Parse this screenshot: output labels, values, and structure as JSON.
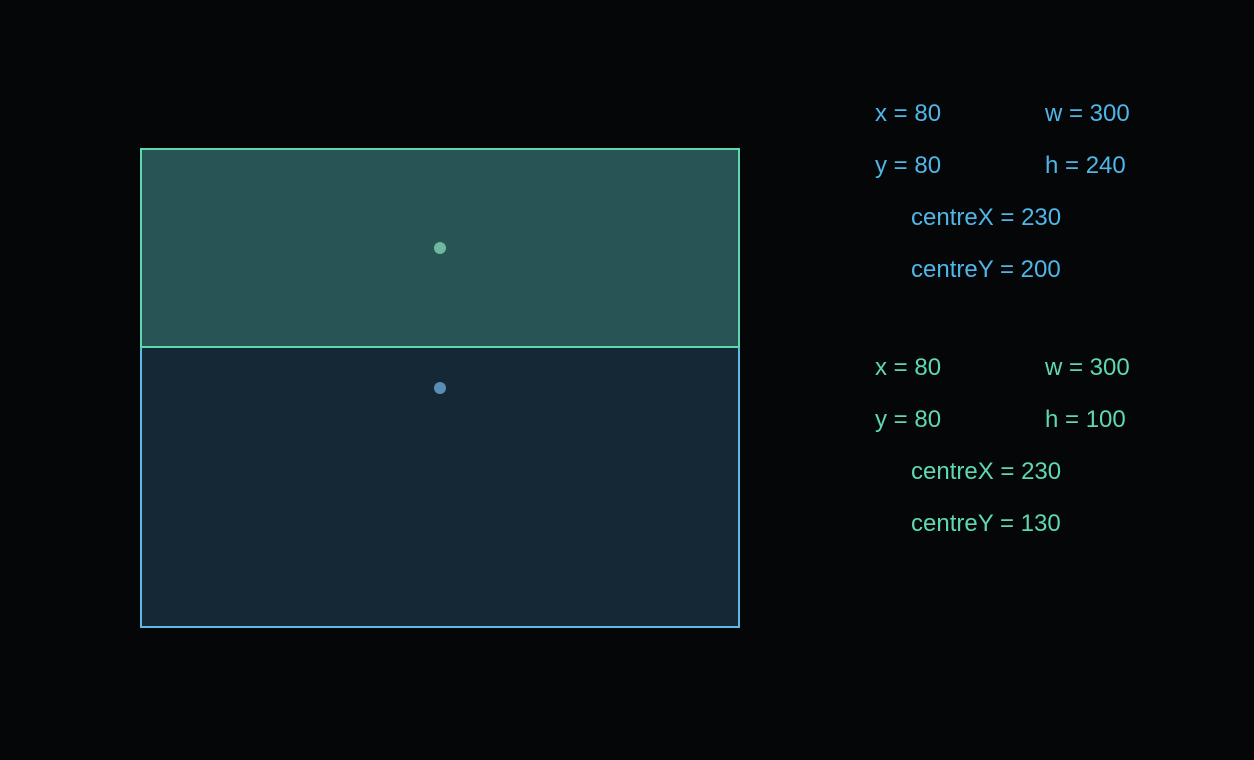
{
  "blue": {
    "x_label": "x = 80",
    "y_label": "y = 80",
    "w_label": "w = 300",
    "h_label": "h = 240",
    "centreX_label": "centreX = 230",
    "centreY_label": "centreY = 200"
  },
  "green": {
    "x_label": "x = 80",
    "y_label": "y = 80",
    "w_label": "w = 300",
    "h_label": "h = 100",
    "centreX_label": "centreX = 230",
    "centreY_label": "centreY = 130"
  }
}
